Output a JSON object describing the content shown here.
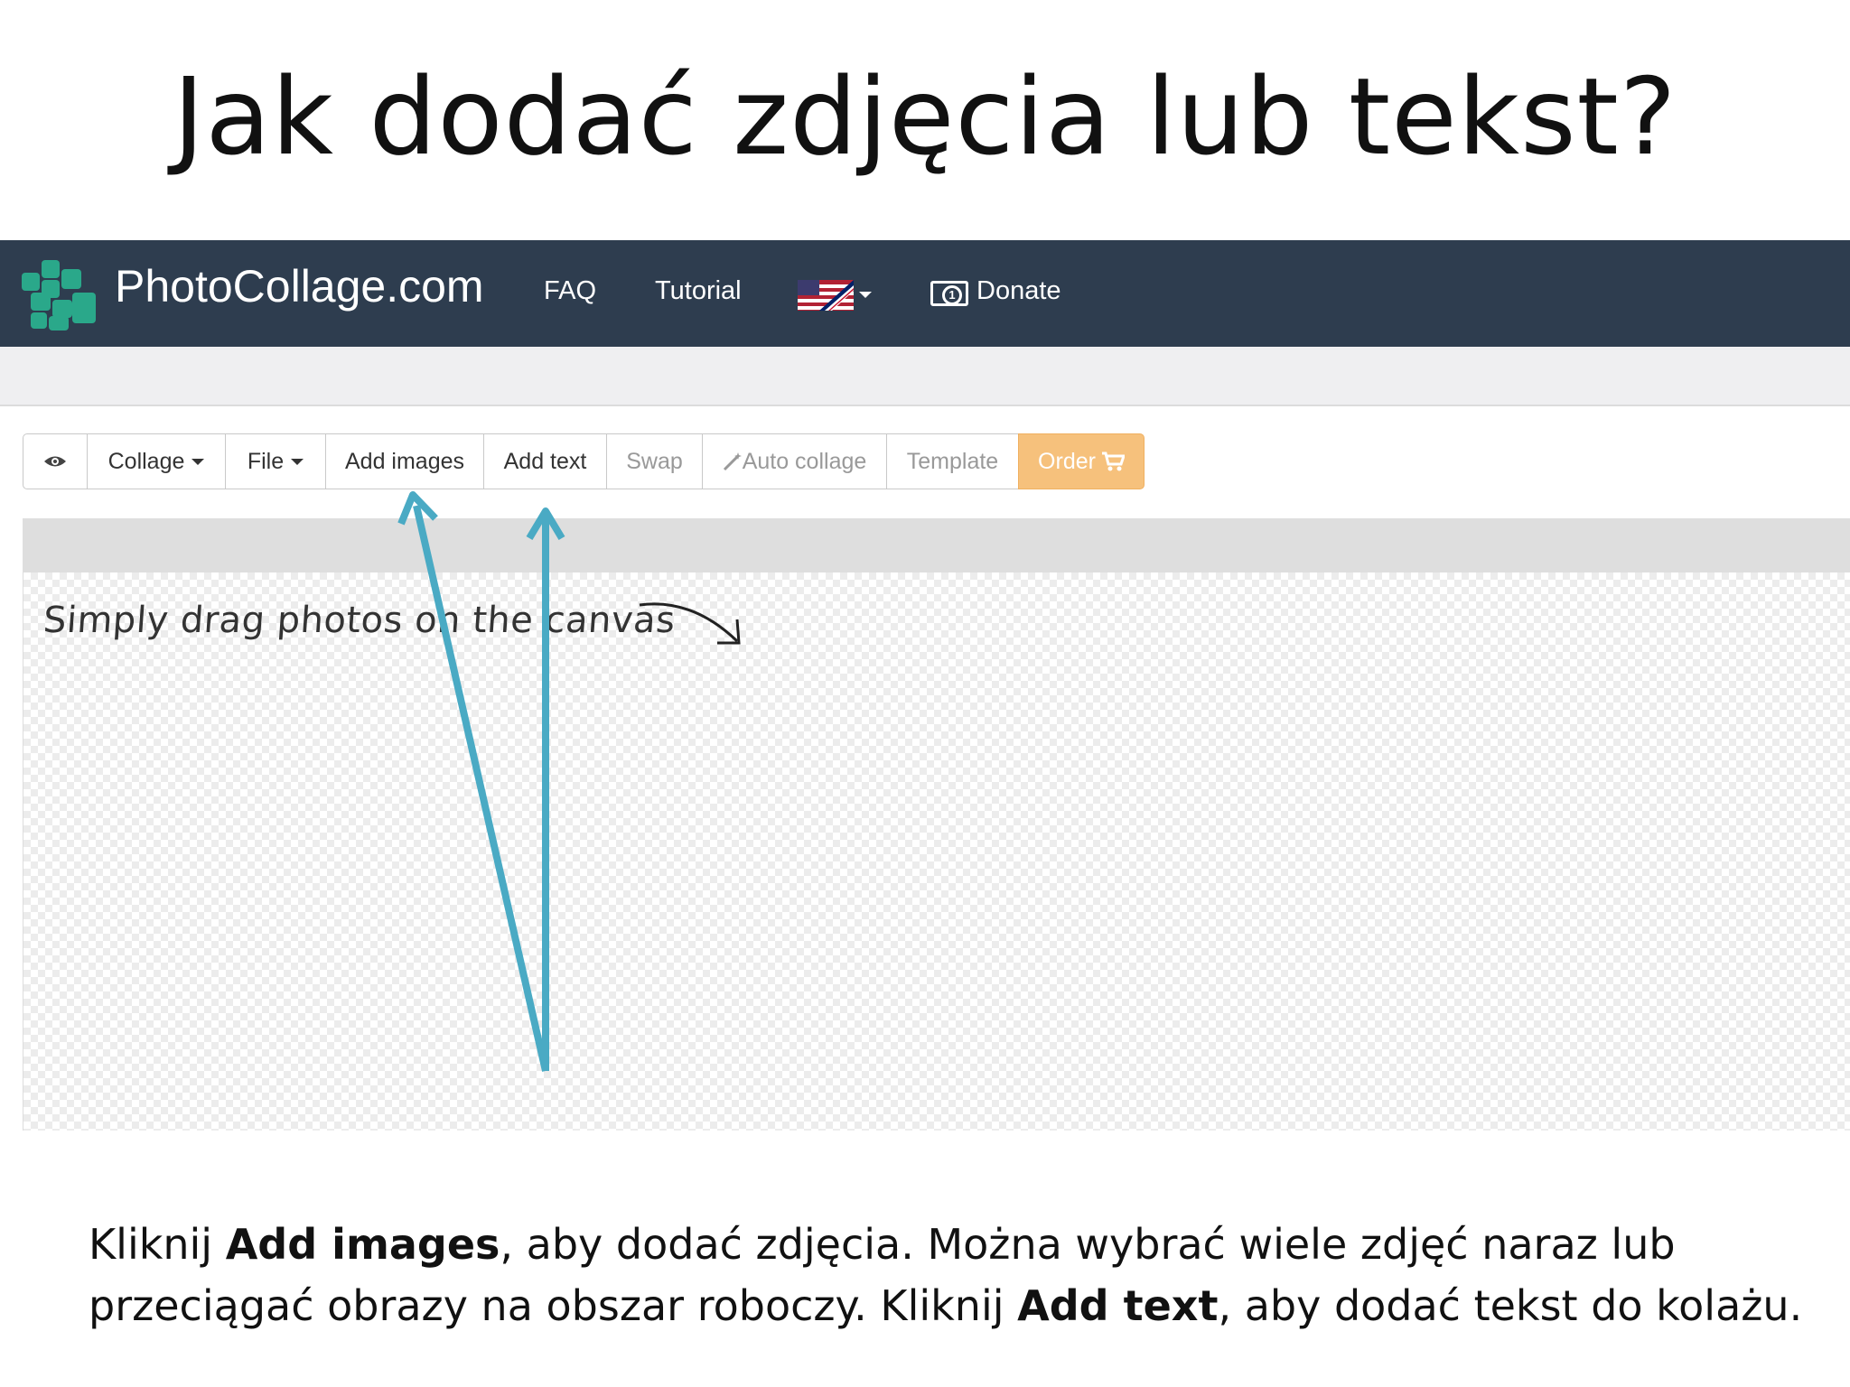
{
  "slide": {
    "title": "Jak dodać zdjęcia lub tekst?",
    "caption": {
      "part1": "Kliknij ",
      "add_images": "Add images",
      "part2": ", aby dodać zdjęcia. Można wybrać wiele zdjęć naraz lub przeciągać obrazy na obszar roboczy. Kliknij ",
      "add_text": "Add text",
      "part3": ", aby dodać tekst do kolażu."
    }
  },
  "navbar": {
    "brand": "PhotoCollage.com",
    "links": {
      "faq": "FAQ",
      "tutorial": "Tutorial",
      "donate": "Donate"
    },
    "language_icon": "us-uk-flag-icon",
    "logo_icon": "photocollage-logo-icon",
    "donate_icon": "money-bill-icon",
    "colors": {
      "background": "#2e3d4f",
      "brand_green": "#2aa88a"
    }
  },
  "toolbar": {
    "preview_icon": "eye-icon",
    "collage": "Collage",
    "file": "File",
    "add_images": "Add images",
    "add_text": "Add text",
    "swap": "Swap",
    "auto_collage": "Auto collage",
    "auto_collage_icon": "magic-wand-icon",
    "template": "Template",
    "order": "Order",
    "order_icon": "cart-icon",
    "colors": {
      "order_bg": "#f6c17c",
      "disabled_text": "#999999"
    }
  },
  "canvas": {
    "hint": "Simply drag photos on the canvas",
    "hint_icon": "curved-arrow-icon"
  },
  "annotations": {
    "arrow_color": "#4aaac4",
    "arrow_icon": "pointer-arrow-icon"
  }
}
